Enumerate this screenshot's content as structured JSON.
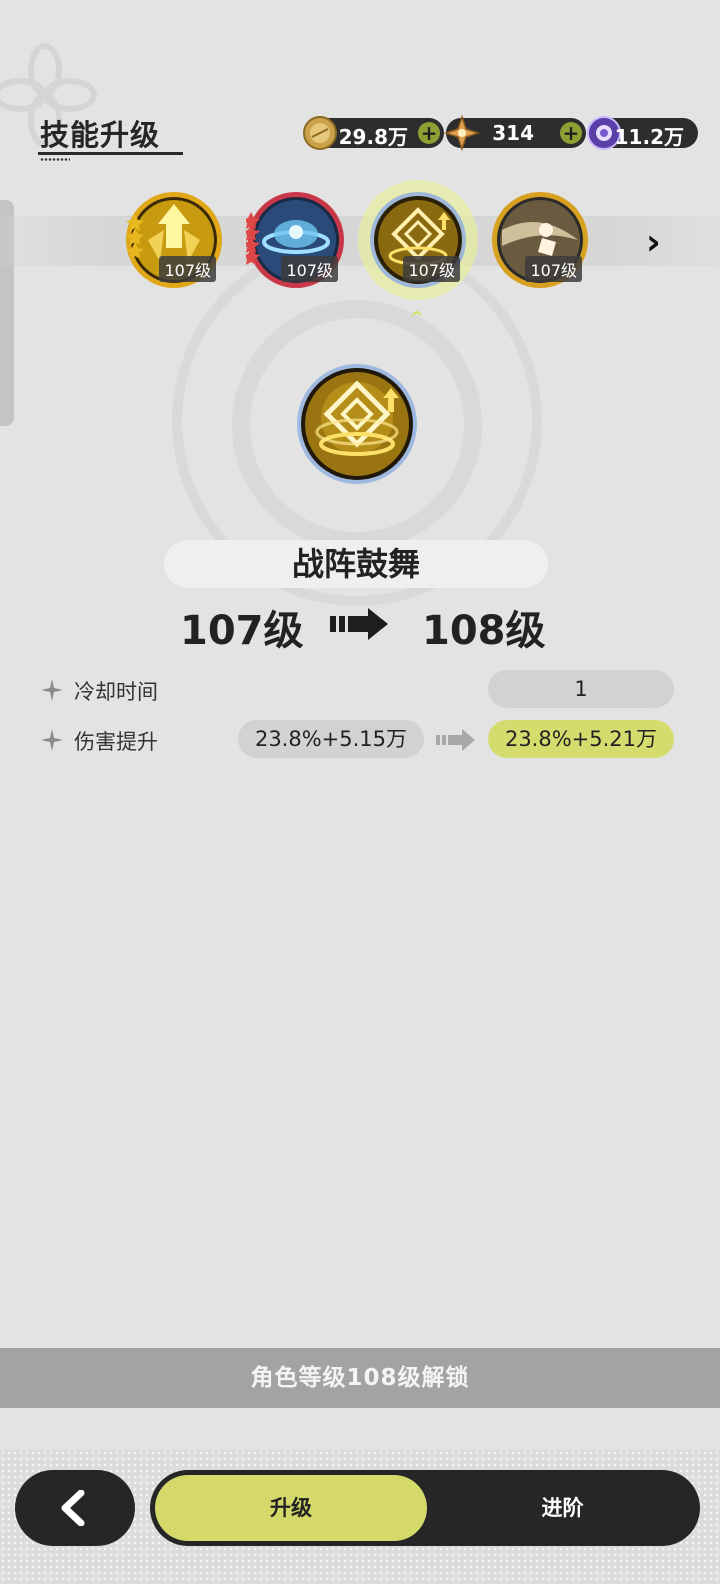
{
  "header": {
    "title": "技能升级"
  },
  "currencies": [
    {
      "icon": "gold-coin-icon",
      "value": "29.8万",
      "has_add": true
    },
    {
      "icon": "star-crystal-icon",
      "value": "314",
      "has_add": true
    },
    {
      "icon": "purple-orb-icon",
      "value": "11.2万",
      "has_add": false
    }
  ],
  "skills": [
    {
      "icon": "gold-arrow-skill-icon",
      "level": "107级",
      "stars": 3,
      "star_color": "#e8b820",
      "selected": false
    },
    {
      "icon": "blue-vortex-skill-icon",
      "level": "107级",
      "stars": 4,
      "star_color": "#e04848",
      "selected": false
    },
    {
      "icon": "rune-tower-skill-icon",
      "level": "107级",
      "stars": 0,
      "selected": true
    },
    {
      "icon": "dash-figure-skill-icon",
      "level": "107级",
      "stars": 0,
      "selected": false
    }
  ],
  "current_skill": {
    "name": "战阵鼓舞",
    "level_from": "107级",
    "level_to": "108级"
  },
  "stats": [
    {
      "label": "冷却时间",
      "value": "1"
    },
    {
      "label": "伤害提升",
      "from": "23.8%+5.15万",
      "to": "23.8%+5.21万"
    }
  ],
  "unlock_text": "角色等级108级解锁",
  "tabs": {
    "upgrade": "升级",
    "advance": "进阶"
  },
  "colors": {
    "accent": "#d5d96a",
    "dark": "#262626"
  }
}
